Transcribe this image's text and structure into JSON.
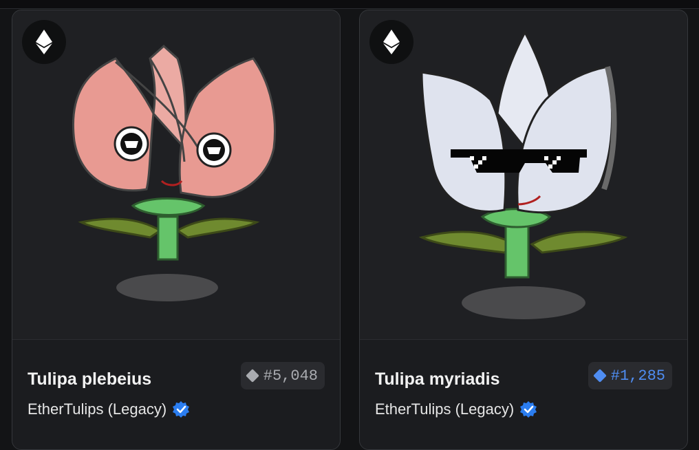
{
  "cards": [
    {
      "title": "Tulipa plebeius",
      "rank": "#5,048",
      "rank_color": "#a9abb0",
      "collection": "EtherTulips (Legacy)",
      "verified": true,
      "chain_icon": "ethereum-icon",
      "art": {
        "petal_color": "#e89a92",
        "face": "surprised-eyes"
      }
    },
    {
      "title": "Tulipa myriadis",
      "rank": "#1,285",
      "rank_color": "#4f8df2",
      "collection": "EtherTulips (Legacy)",
      "verified": true,
      "chain_icon": "ethereum-icon",
      "art": {
        "petal_color": "#dfe3ee",
        "face": "pixel-sunglasses"
      }
    }
  ],
  "colors": {
    "verified_blue": "#2b7df0",
    "background": "#131416",
    "card": "#1f2023"
  }
}
